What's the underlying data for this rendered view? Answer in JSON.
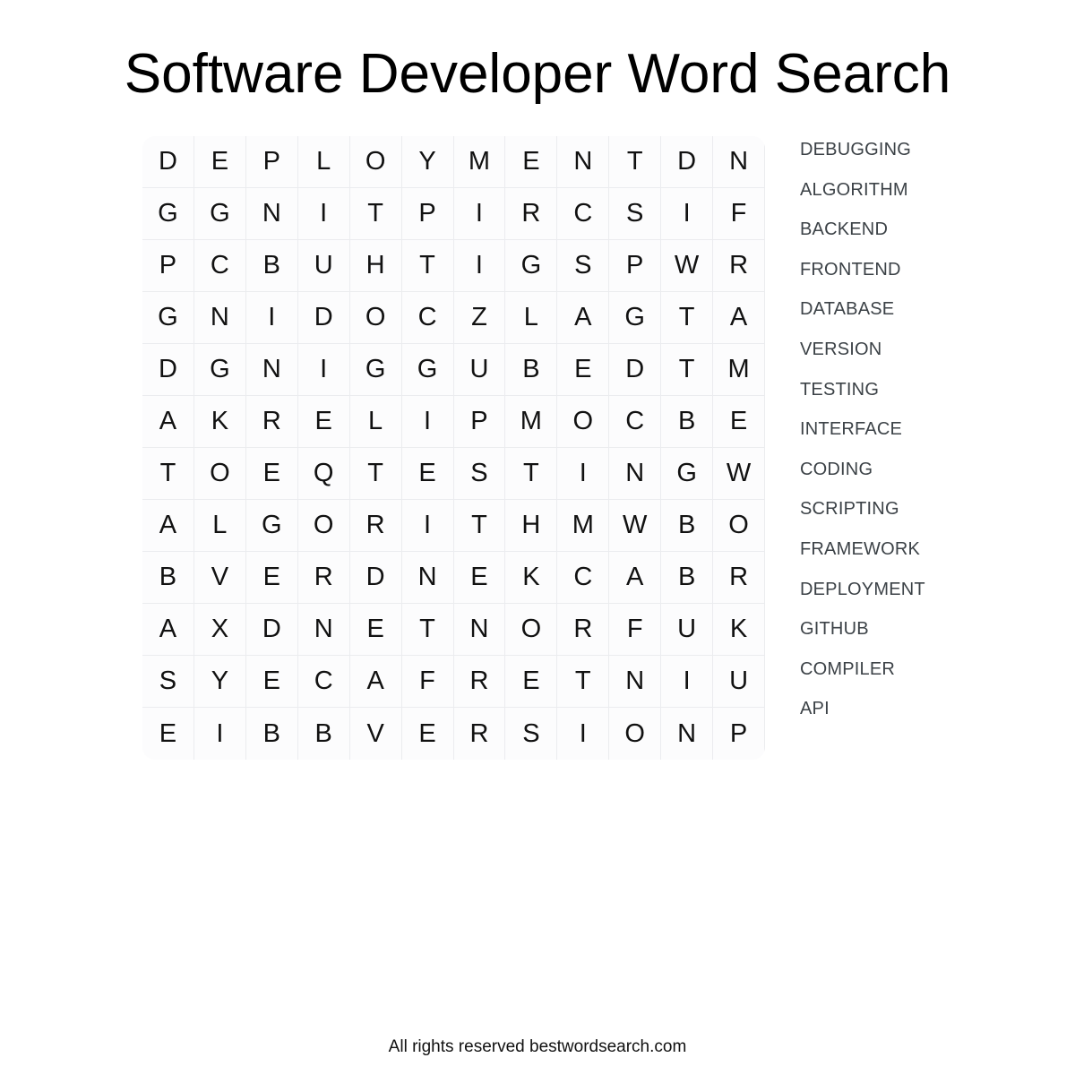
{
  "page": {
    "title": "Software Developer Word Search",
    "footer": "All rights reserved bestwordsearch.com",
    "background_color": "#ffffff",
    "title_color": "#000000",
    "letter_color": "#111111",
    "cell_border_color": "#ebecef",
    "cell_background": "#fcfcfd",
    "word_list_color": "#3c4247"
  },
  "grid": {
    "rows": 12,
    "cols": 12,
    "letters": [
      [
        "D",
        "E",
        "P",
        "L",
        "O",
        "Y",
        "M",
        "E",
        "N",
        "T",
        "D",
        "N"
      ],
      [
        "G",
        "G",
        "N",
        "I",
        "T",
        "P",
        "I",
        "R",
        "C",
        "S",
        "I",
        "F"
      ],
      [
        "P",
        "C",
        "B",
        "U",
        "H",
        "T",
        "I",
        "G",
        "S",
        "P",
        "W",
        "R"
      ],
      [
        "G",
        "N",
        "I",
        "D",
        "O",
        "C",
        "Z",
        "L",
        "A",
        "G",
        "T",
        "A"
      ],
      [
        "D",
        "G",
        "N",
        "I",
        "G",
        "G",
        "U",
        "B",
        "E",
        "D",
        "T",
        "M"
      ],
      [
        "A",
        "K",
        "R",
        "E",
        "L",
        "I",
        "P",
        "M",
        "O",
        "C",
        "B",
        "E"
      ],
      [
        "T",
        "O",
        "E",
        "Q",
        "T",
        "E",
        "S",
        "T",
        "I",
        "N",
        "G",
        "W"
      ],
      [
        "A",
        "L",
        "G",
        "O",
        "R",
        "I",
        "T",
        "H",
        "M",
        "W",
        "B",
        "O"
      ],
      [
        "B",
        "V",
        "E",
        "R",
        "D",
        "N",
        "E",
        "K",
        "C",
        "A",
        "B",
        "R"
      ],
      [
        "A",
        "X",
        "D",
        "N",
        "E",
        "T",
        "N",
        "O",
        "R",
        "F",
        "U",
        "K"
      ],
      [
        "S",
        "Y",
        "E",
        "C",
        "A",
        "F",
        "R",
        "E",
        "T",
        "N",
        "I",
        "U"
      ],
      [
        "E",
        "I",
        "B",
        "B",
        "V",
        "E",
        "R",
        "S",
        "I",
        "O",
        "N",
        "P"
      ]
    ]
  },
  "word_list": {
    "words": [
      "DEBUGGING",
      "ALGORITHM",
      "BACKEND",
      "FRONTEND",
      "DATABASE",
      "VERSION",
      "TESTING",
      "INTERFACE",
      "CODING",
      "SCRIPTING",
      "FRAMEWORK",
      "DEPLOYMENT",
      "GITHUB",
      "COMPILER",
      "API"
    ]
  }
}
